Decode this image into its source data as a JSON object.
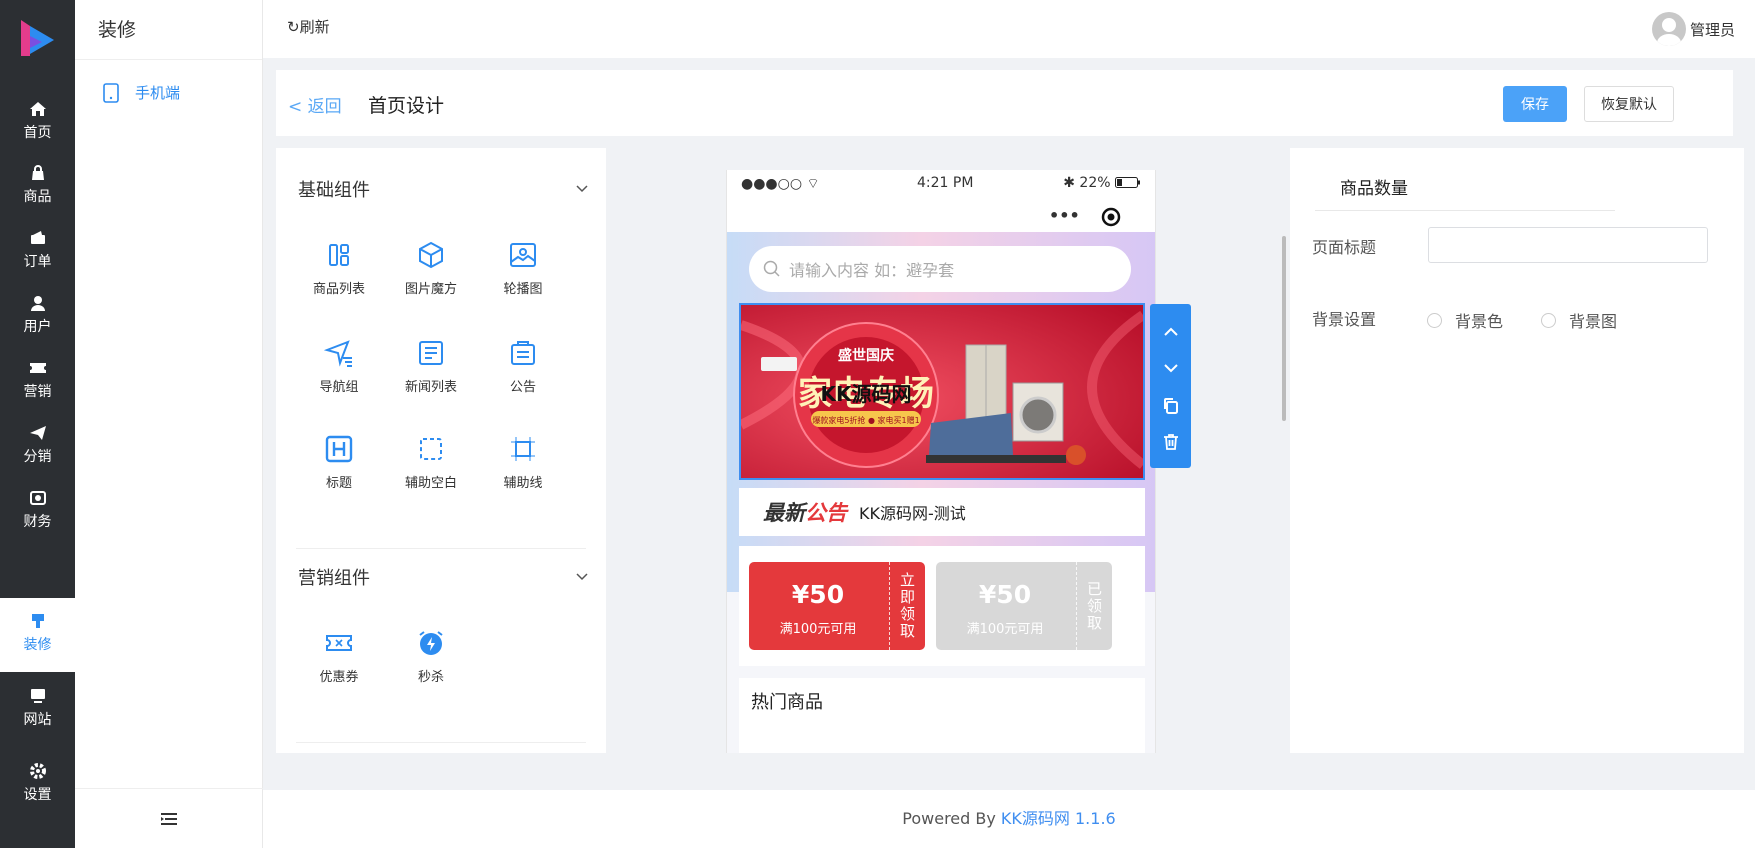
{
  "sidebar": {
    "items": [
      {
        "label": "首页",
        "icon": "home-icon"
      },
      {
        "label": "商品",
        "icon": "bag-icon"
      },
      {
        "label": "订单",
        "icon": "wallet-icon"
      },
      {
        "label": "用户",
        "icon": "user-icon"
      },
      {
        "label": "营销",
        "icon": "ticket-icon"
      },
      {
        "label": "分销",
        "icon": "paper-plane-icon"
      },
      {
        "label": "财务",
        "icon": "money-icon"
      },
      {
        "label": "装修",
        "icon": "brush-icon"
      },
      {
        "label": "网站",
        "icon": "monitor-icon"
      },
      {
        "label": "设置",
        "icon": "gear-icon"
      }
    ],
    "active_index": 7
  },
  "submenu": {
    "title": "装修",
    "items": [
      {
        "label": "手机端",
        "icon": "mobile-icon"
      }
    ]
  },
  "topbar": {
    "refresh_label": "刷新",
    "admin_name": "管理员"
  },
  "header": {
    "back_label": "< 返回",
    "title": "首页设计",
    "save_label": "保存",
    "restore_label": "恢复默认"
  },
  "components": {
    "basic_title": "基础组件",
    "basic": [
      {
        "label": "商品列表",
        "icon": "grid-list-icon"
      },
      {
        "label": "图片魔方",
        "icon": "cube-icon"
      },
      {
        "label": "轮播图",
        "icon": "image-icon"
      },
      {
        "label": "导航组",
        "icon": "navigation-icon"
      },
      {
        "label": "新闻列表",
        "icon": "news-icon"
      },
      {
        "label": "公告",
        "icon": "notice-icon"
      },
      {
        "label": "标题",
        "icon": "heading-icon"
      },
      {
        "label": "辅助空白",
        "icon": "blank-icon"
      },
      {
        "label": "辅助线",
        "icon": "guide-line-icon"
      }
    ],
    "marketing_title": "营销组件",
    "marketing": [
      {
        "label": "优惠券",
        "icon": "coupon-icon"
      },
      {
        "label": "秒杀",
        "icon": "alarm-icon"
      }
    ]
  },
  "phone": {
    "status_left": "●●●○○",
    "time": "4:21 PM",
    "battery": "22%",
    "search_placeholder": "请输入内容 如：避孕套",
    "banner": {
      "badge": "盛世国庆",
      "headline": "家电专场",
      "sub": "爆款家电5折抢 ● 家电买1赠1",
      "watermark": "KK源码网"
    },
    "notice": {
      "brand_prefix": "最新",
      "brand_suffix": "公告",
      "text": "KK源码网-测试"
    },
    "coupons": [
      {
        "amount": "¥50",
        "condition": "满100元可用",
        "action": "立即领取",
        "color": "#e4393c"
      },
      {
        "amount": "¥50",
        "condition": "满100元可用",
        "action": "已领取",
        "color": "#d8d8d8"
      }
    ],
    "hot_title": "热门商品"
  },
  "settings": {
    "tab": "商品数量",
    "page_title_label": "页面标题",
    "page_title_value": "",
    "bg_label": "背景设置",
    "bg_options": [
      "背景色",
      "背景图"
    ]
  },
  "footer": {
    "prefix": "Powered By ",
    "link": "KK源码网 1.1.6"
  },
  "colors": {
    "accent": "#2d8cf0",
    "sidebar_bg": "#2c2f33",
    "coupon_active": "#e4393c"
  }
}
